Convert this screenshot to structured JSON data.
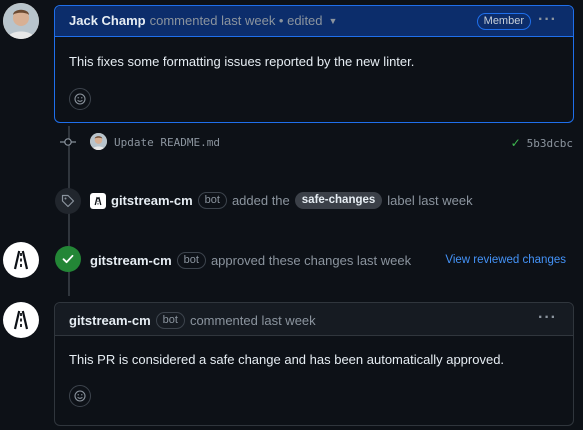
{
  "comment1": {
    "author": "Jack Champ",
    "meta": "commented last week • edited",
    "badge": "Member",
    "body": "This fixes some formatting issues reported by the new linter."
  },
  "commit": {
    "message": "Update README.md",
    "sha": "5b3dcbc"
  },
  "label_event": {
    "actor": "gitstream-cm",
    "bot_badge": "bot",
    "text_before": "added the",
    "label": "safe-changes",
    "text_after": "label last week"
  },
  "review_event": {
    "actor": "gitstream-cm",
    "bot_badge": "bot",
    "text": "approved these changes last week",
    "link": "View reviewed changes"
  },
  "comment2": {
    "author": "gitstream-cm",
    "bot_badge": "bot",
    "meta": "commented last week",
    "body": "This PR is considered a safe change and has been automatically approved."
  },
  "colors": {
    "accent": "#1f6feb",
    "success": "#238636",
    "link": "#4493f8",
    "background": "#0d1117"
  }
}
